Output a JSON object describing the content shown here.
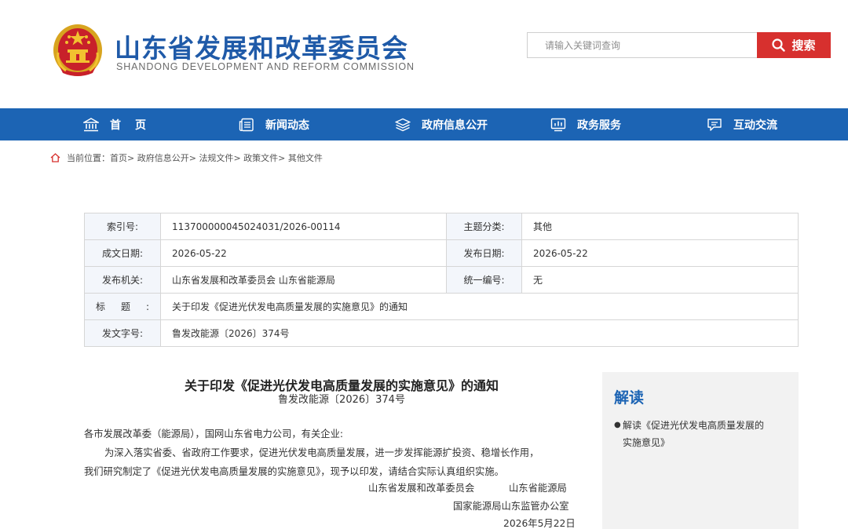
{
  "header": {
    "site_title": "山东省发展和改革委员会",
    "site_subtitle": "SHANDONG DEVELOPMENT AND REFORM COMMISSION",
    "search_placeholder": "请输入关键词查询",
    "search_button": "搜索",
    "emblem_icon": "national-emblem-icon"
  },
  "nav": {
    "items": [
      {
        "label": "首页",
        "icon": "building-icon"
      },
      {
        "label": "新闻动态",
        "icon": "news-icon"
      },
      {
        "label": "政府信息公开",
        "icon": "layers-icon"
      },
      {
        "label": "政务服务",
        "icon": "monitor-icon"
      },
      {
        "label": "互动交流",
        "icon": "chat-icon"
      }
    ]
  },
  "breadcrumb": {
    "prefix": "当前位置：",
    "items": [
      "首页",
      "政府信息公开",
      "法规文件",
      "政策文件",
      "其他文件"
    ]
  },
  "meta": {
    "index_label": "索引号:",
    "index_value": "113700000045024031/2026-00114",
    "topic_label": "主题分类:",
    "topic_value": "其他",
    "created_label": "成文日期:",
    "created_value": "2026-05-22",
    "published_label": "发布日期:",
    "published_value": "2026-05-22",
    "issuer_label": "发布机关:",
    "issuer_value": "山东省发展和改革委员会 山东省能源局",
    "serial_label": "统一编号:",
    "serial_value": "无",
    "title_label": "标题:",
    "title_value": "关于印发《促进光伏发电高质量发展的实施意见》的通知",
    "docno_label": "发文字号:",
    "docno_value": "鲁发改能源〔2026〕374号"
  },
  "article": {
    "title": "关于印发《促进光伏发电高质量发展的实施意见》的通知",
    "doc_number": "鲁发改能源〔2026〕374号",
    "salutation": "各市发展改革委（能源局），国网山东省电力公司，有关企业:",
    "para1_line1": "为深入落实省委、省政府工作要求，促进光伏发电高质量发展，进一步发挥能源扩投资、稳增长作用，",
    "para1_line2": "我们研究制定了《促进光伏发电高质量发展的实施意见》，现予以印发，请结合实际认真组织实施。",
    "signer1": "山东省发展和改革委员会",
    "signer2": "山东省能源局",
    "signer3": "国家能源局山东监管办公室",
    "date": "2026年5月22日"
  },
  "sidebar": {
    "title": "解读",
    "item_line1": "解读《促进光伏发电高质量发展的",
    "item_line2": "实施意见》"
  },
  "colors": {
    "brand_blue": "#1c64b4",
    "search_red": "#d7302e",
    "title_blue": "#1f5aa8"
  }
}
